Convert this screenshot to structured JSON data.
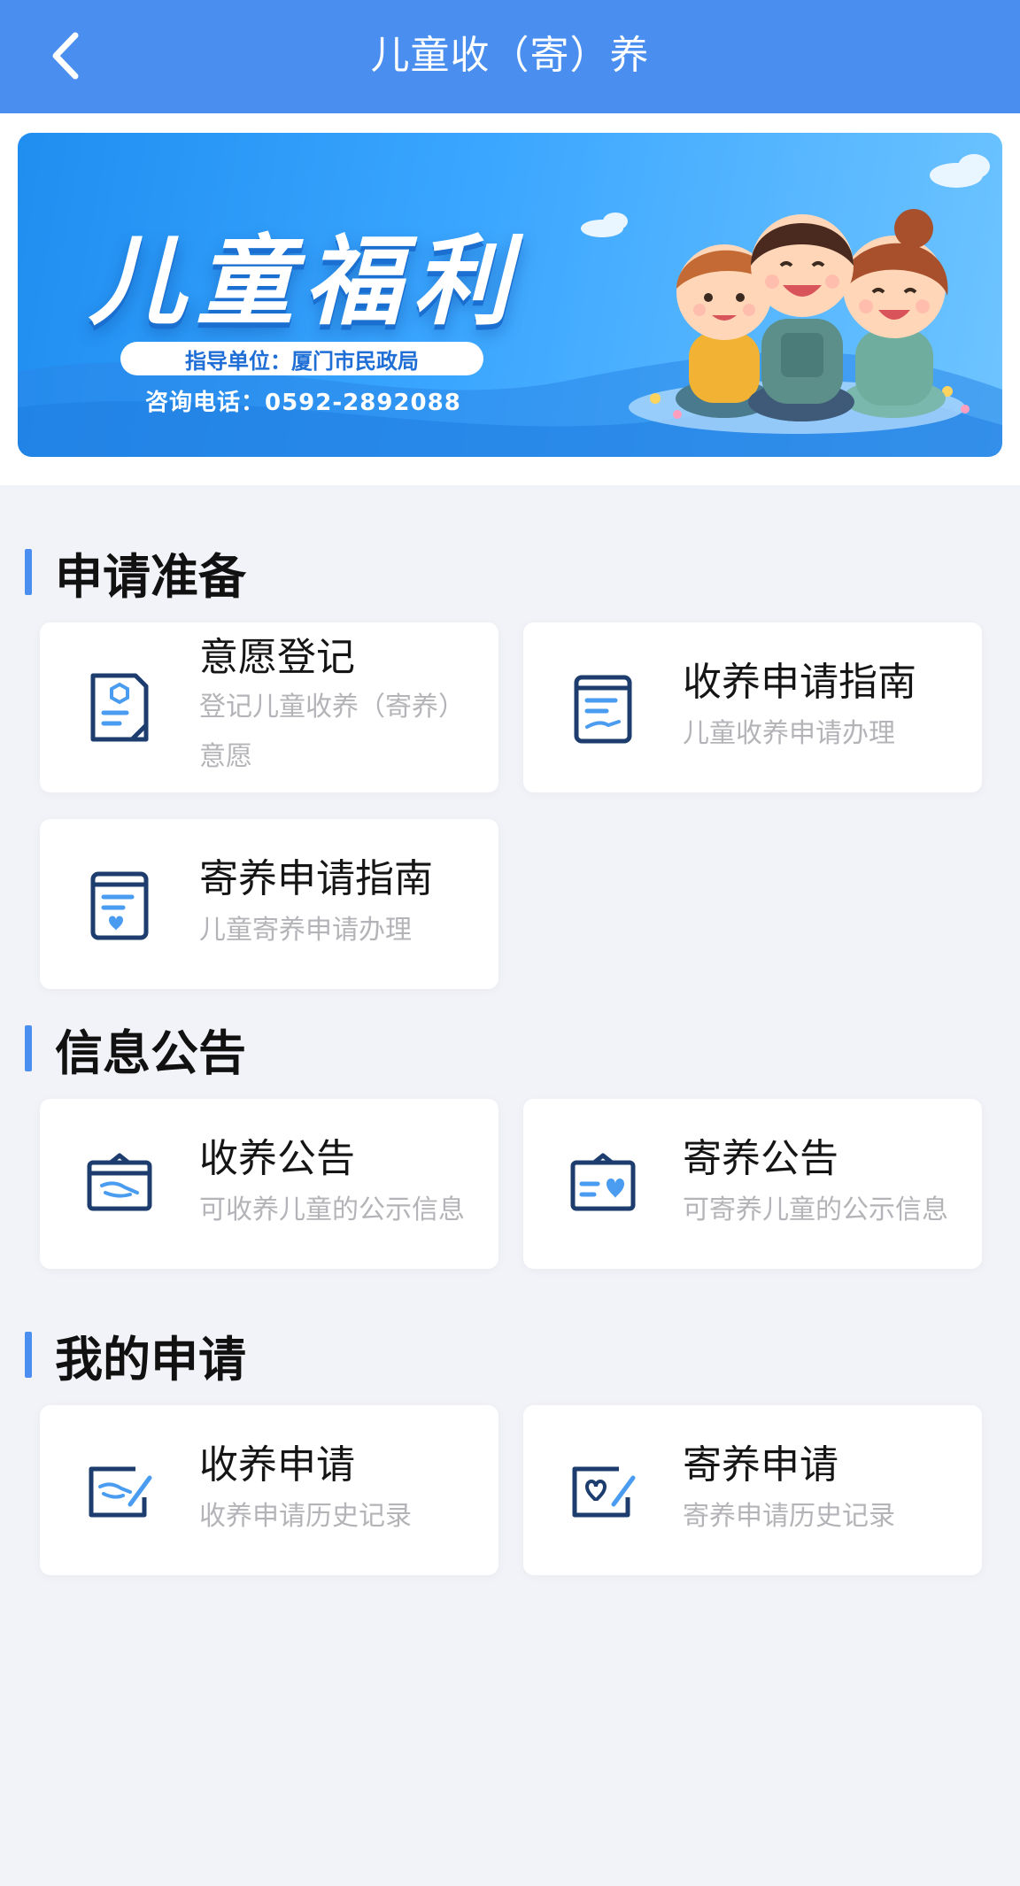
{
  "header": {
    "title": "儿童收（寄）养",
    "back_icon": "chevron-left-icon"
  },
  "banner": {
    "title": "儿童福利",
    "guide_unit": "指导单位：厦门市民政局",
    "phone": "咨询电话：0592-2892088"
  },
  "sections": [
    {
      "title": "申请准备",
      "cards": [
        {
          "title": "意愿登记",
          "subtitle": "登记儿童收养（寄养）意愿",
          "icon": "registration-document-icon"
        },
        {
          "title": "收养申请指南",
          "subtitle": "儿童收养申请办理",
          "icon": "adoption-guide-icon"
        },
        {
          "title": "寄养申请指南",
          "subtitle": "儿童寄养申请办理",
          "icon": "foster-guide-icon"
        }
      ]
    },
    {
      "title": "信息公告",
      "cards": [
        {
          "title": "收养公告",
          "subtitle": "可收养儿童的公示信息",
          "icon": "adoption-notice-icon"
        },
        {
          "title": "寄养公告",
          "subtitle": "可寄养儿童的公示信息",
          "icon": "foster-notice-icon"
        }
      ]
    },
    {
      "title": "我的申请",
      "cards": [
        {
          "title": "收养申请",
          "subtitle": "收养申请历史记录",
          "icon": "adoption-application-icon"
        },
        {
          "title": "寄养申请",
          "subtitle": "寄养申请历史记录",
          "icon": "foster-application-icon"
        }
      ]
    }
  ],
  "colors": {
    "header": "#4a8ff0",
    "accent": "#4a8ff0",
    "icon_dark": "#1d3d6e",
    "icon_light": "#4a9cf0",
    "page_bg": "#f2f3f8"
  }
}
